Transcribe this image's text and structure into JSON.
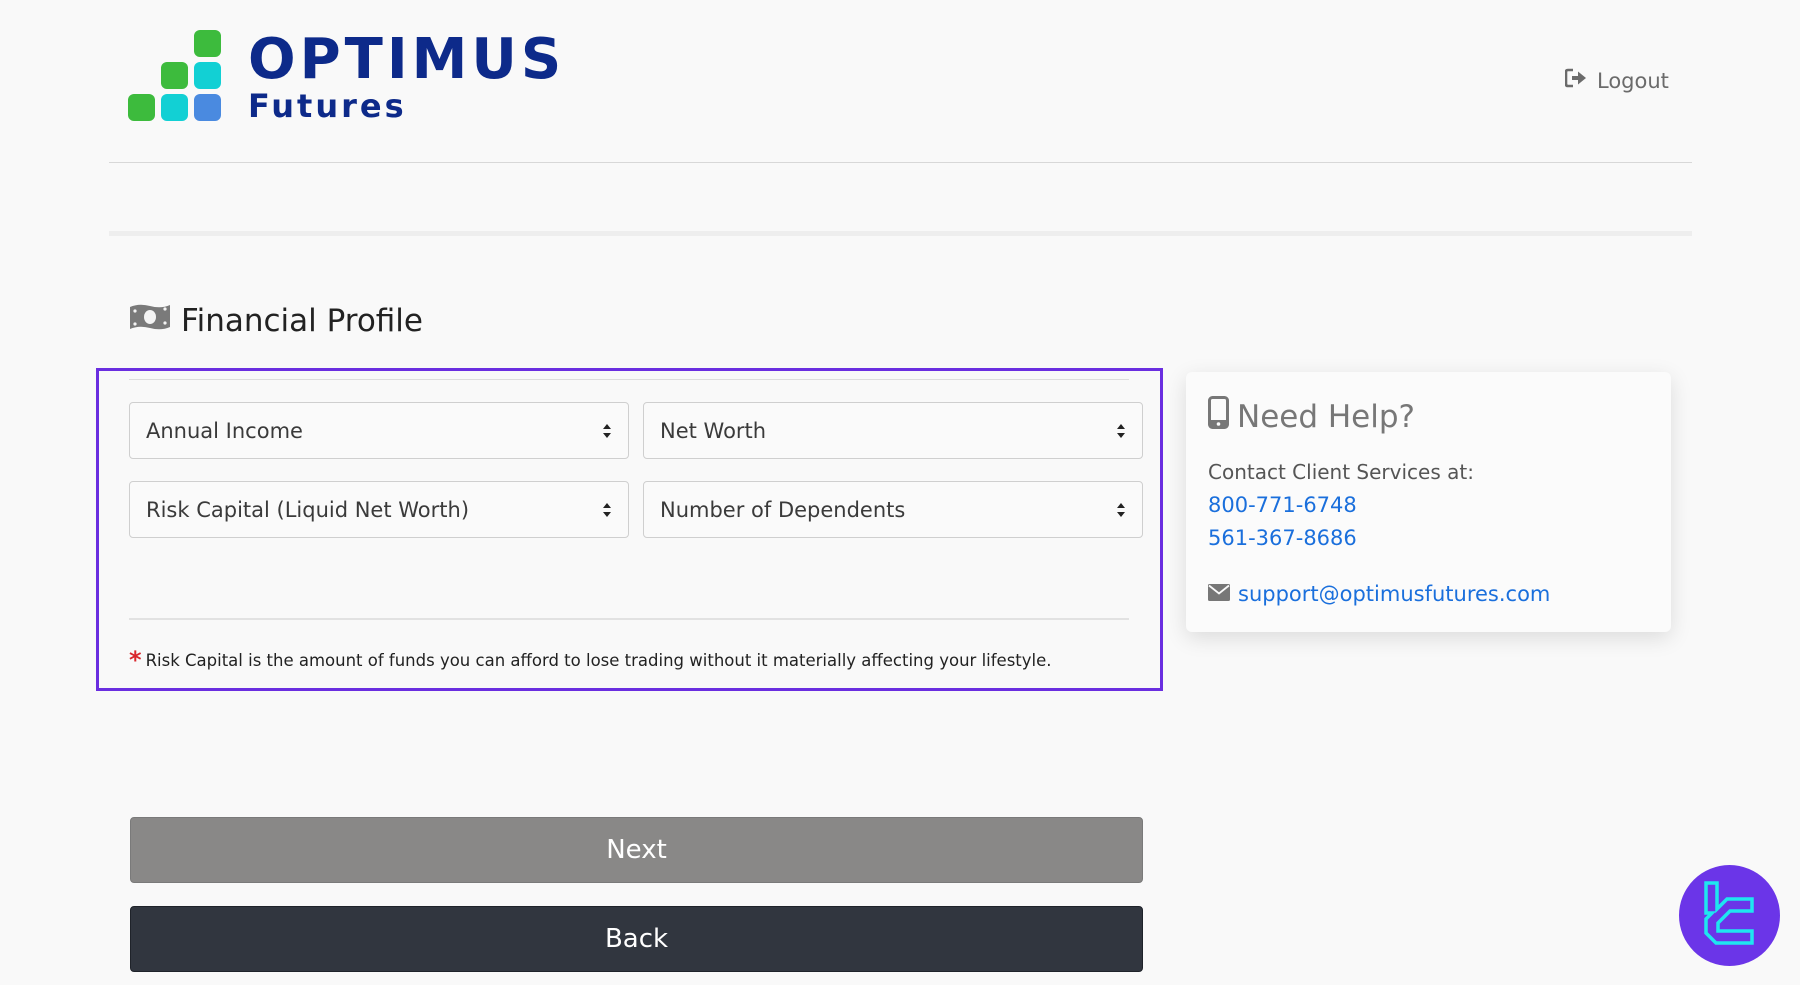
{
  "header": {
    "logo": {
      "brand": "OPTIMUS",
      "sub": "Futures",
      "colors": {
        "text": "#0d2a8a",
        "green": "#3dbb3d",
        "cyan": "#12d0d4",
        "blue": "#4a8ae0"
      }
    },
    "logout_label": "Logout",
    "logout_icon": "sign-out-icon"
  },
  "section": {
    "title": "Financial Profile",
    "icon": "money-bill-icon"
  },
  "form": {
    "highlight_color": "#6a2ee0",
    "selects": [
      {
        "name": "annual-income",
        "value": "Annual Income"
      },
      {
        "name": "net-worth",
        "value": "Net Worth"
      },
      {
        "name": "risk-capital",
        "value": "Risk Capital (Liquid Net Worth)"
      },
      {
        "name": "number-of-dependents",
        "value": "Number of Dependents"
      }
    ],
    "note_marker": "*",
    "note": "Risk Capital is the amount of funds you can afford to lose trading without it materially affecting your lifestyle."
  },
  "help": {
    "title": "Need Help?",
    "icon": "mobile-phone-icon",
    "contact_label": "Contact Client Services at:",
    "phones": [
      "800-771-6748",
      "561-367-8686"
    ],
    "email_icon": "envelope-icon",
    "email": "support@optimusfutures.com",
    "link_color": "#1a6fdc"
  },
  "buttons": {
    "next_label": "Next",
    "back_label": "Back"
  },
  "badge": {
    "icon": "tradingfinder-logo-icon",
    "color": "#6b35e8"
  }
}
